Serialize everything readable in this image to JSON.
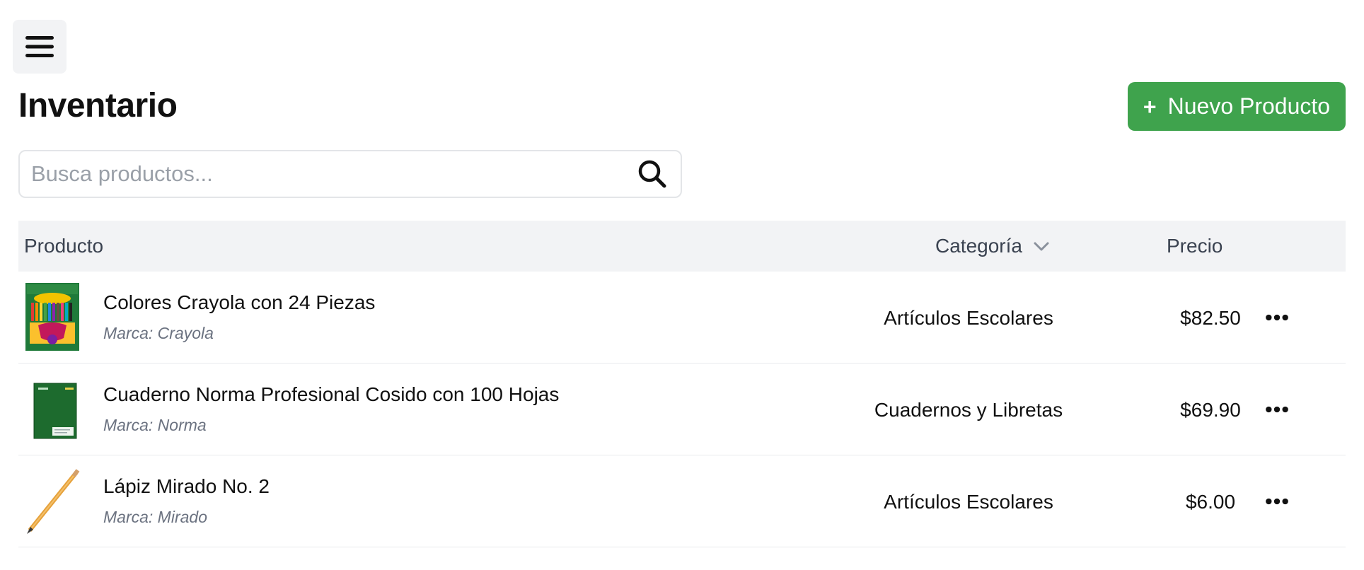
{
  "header": {
    "menu_icon": "hamburger-menu-icon",
    "title": "Inventario",
    "new_button_icon": "+",
    "new_button_label": "Nuevo Producto",
    "accent_color": "#3fa34d"
  },
  "search": {
    "placeholder": "Busca productos...",
    "value": "",
    "icon": "search-icon"
  },
  "table": {
    "columns": {
      "product": "Producto",
      "category": "Categoría",
      "price": "Precio"
    },
    "rows": [
      {
        "name": "Colores Crayola con 24 Piezas",
        "brand": "Marca: Crayola",
        "category": "Artículos Escolares",
        "price": "$82.50",
        "thumbnail": "crayola-colored-pencils-box"
      },
      {
        "name": "Cuaderno Norma Profesional Cosido con 100 Hojas",
        "brand": "Marca: Norma",
        "category": "Cuadernos y Libretas",
        "price": "$69.90",
        "thumbnail": "green-notebook"
      },
      {
        "name": "Lápiz Mirado No. 2",
        "brand": "Marca: Mirado",
        "category": "Artículos Escolares",
        "price": "$6.00",
        "thumbnail": "yellow-pencil"
      }
    ]
  }
}
